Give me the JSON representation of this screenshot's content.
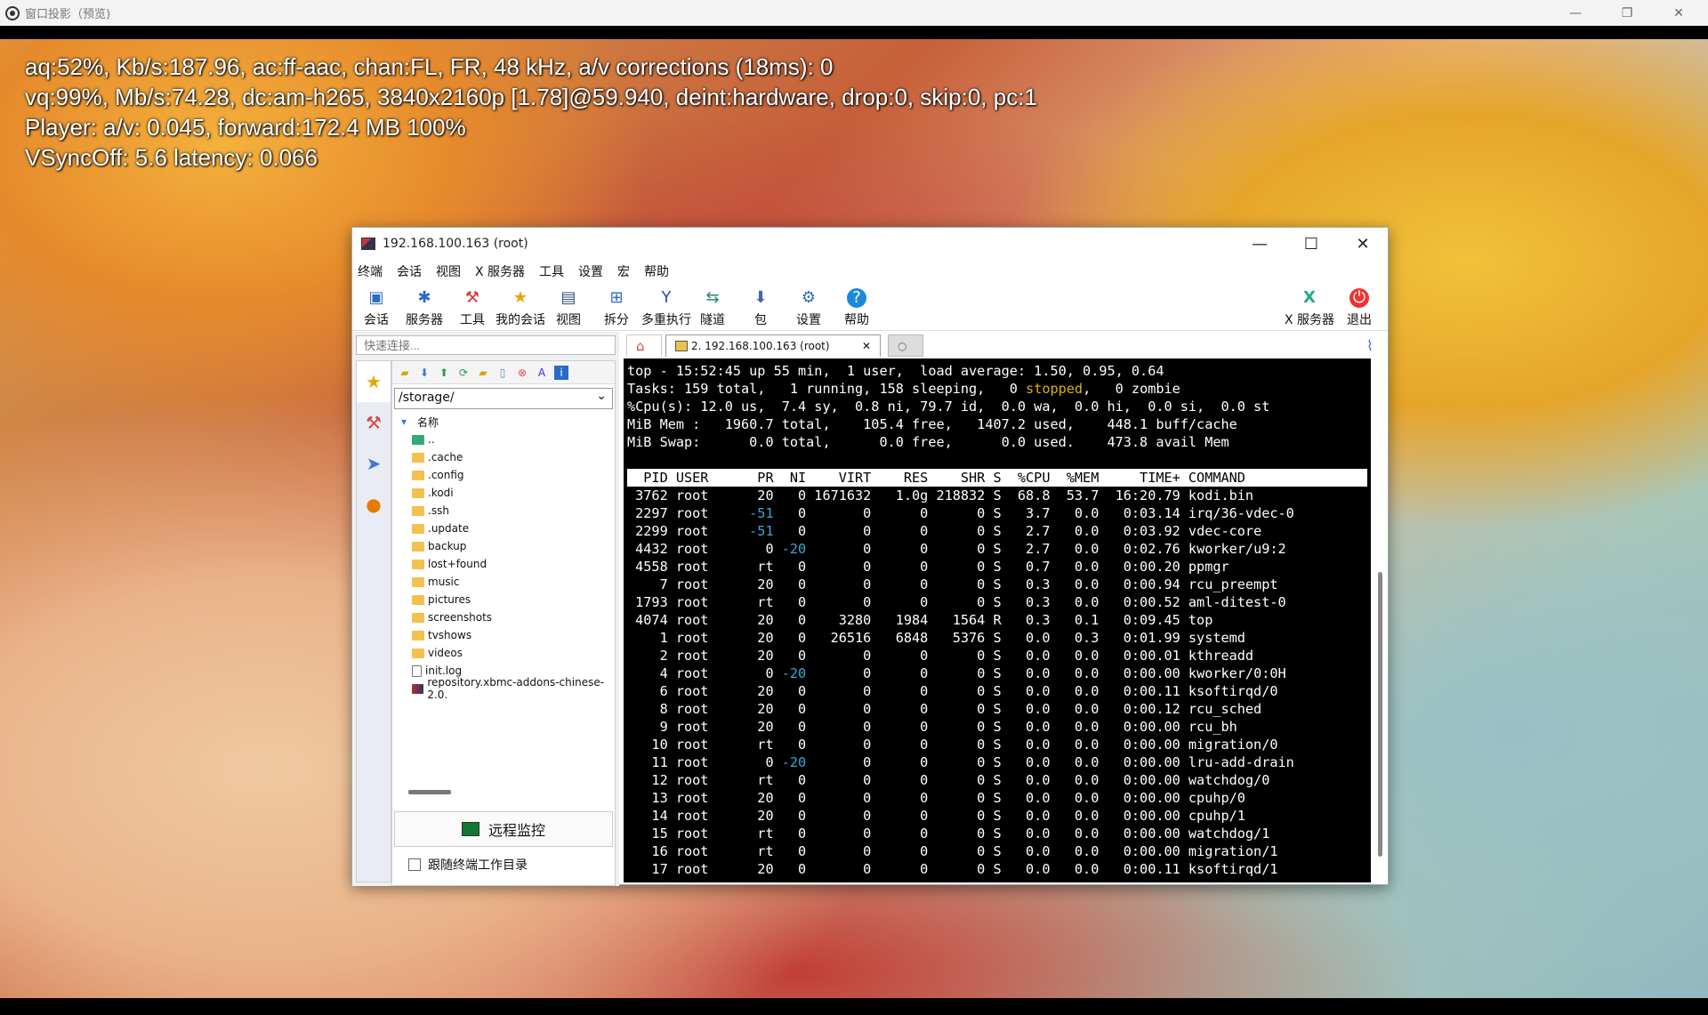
{
  "outer_window": {
    "title": "窗口投影（预览)",
    "minimize": "—",
    "restore": "❐",
    "close": "✕"
  },
  "osd": [
    "aq:52%, Kb/s:187.96, ac:ff-aac, chan:FL, FR, 48 kHz, a/v corrections (18ms): 0",
    "vq:99%, Mb/s:74.28, dc:am-h265, 3840x2160p [1.78]@59.940, deint:hardware, drop:0, skip:0, pc:1",
    "Player: a/v: 0.045,  forward:172.4 MB 100%",
    "VSyncOff: 5.6 latency: 0.066"
  ],
  "app": {
    "title": "192.168.100.163 (root)",
    "minimize": "—",
    "maximize": "☐",
    "close": "✕",
    "menu": [
      "终端",
      "会话",
      "视图",
      "X 服务器",
      "工具",
      "设置",
      "宏",
      "帮助"
    ],
    "toolbar": [
      {
        "label": "会话",
        "icon": "monitor-icon"
      },
      {
        "label": "服务器",
        "icon": "network-icon"
      },
      {
        "label": "工具",
        "icon": "tools-icon"
      },
      {
        "label": "我的会话",
        "icon": "star-icon"
      },
      {
        "label": "视图",
        "icon": "view-icon"
      },
      {
        "label": "拆分",
        "icon": "split-icon"
      },
      {
        "label": "多重执行",
        "icon": "fork-icon"
      },
      {
        "label": "隧道",
        "icon": "tunnel-icon"
      },
      {
        "label": "包",
        "icon": "package-icon"
      },
      {
        "label": "设置",
        "icon": "gear-icon"
      },
      {
        "label": "帮助",
        "icon": "help-icon"
      },
      {
        "label": "X 服务器",
        "icon": "x-server-icon"
      },
      {
        "label": "退出",
        "icon": "power-icon"
      }
    ],
    "quick_connect_placeholder": "快速连接...",
    "path": "/storage/",
    "tree_header": "名称",
    "files": [
      "..",
      ".cache",
      ".config",
      ".kodi",
      ".ssh",
      ".update",
      "backup",
      "lost+found",
      "music",
      "pictures",
      "screenshots",
      "tvshows",
      "videos",
      "init.log",
      "repository.xbmc-addons-chinese-2.0."
    ],
    "remote_monitor": "远程监控",
    "follow_dir": "跟随终端工作目录",
    "tab_label": "2. 192.168.100.163 (root)",
    "tab_close": "✕"
  },
  "terminal": {
    "summary": [
      "top - 15:52:45 up 55 min,  1 user,  load average: 1.50, 0.95, 0.64",
      "Tasks: 159 total,   1 running, 158 sleeping,   0 stopped,   0 zombie",
      "%Cpu(s): 12.0 us,  7.4 sy,  0.8 ni, 79.7 id,  0.0 wa,  0.0 hi,  0.0 si,  0.0 st",
      "MiB Mem :   1960.7 total,    105.4 free,   1407.2 used,    448.1 buff/cache",
      "MiB Swap:      0.0 total,      0.0 free,      0.0 used.    473.8 avail Mem"
    ],
    "header": "  PID USER      PR  NI    VIRT    RES    SHR S  %CPU  %MEM     TIME+ COMMAND",
    "rows": [
      " 3762 root      20   0 1671632   1.0g 218832 S  68.8  53.7  16:20.79 kodi.bin",
      " 2297 root     -51   0       0      0      0 S   3.7   0.0   0:03.14 irq/36-vdec-0",
      " 2299 root     -51   0       0      0      0 S   2.7   0.0   0:03.92 vdec-core",
      " 4432 root       0 -20       0      0      0 S   2.7   0.0   0:02.76 kworker/u9:2",
      " 4558 root      rt   0       0      0      0 S   0.7   0.0   0:00.20 ppmgr",
      "    7 root      20   0       0      0      0 S   0.3   0.0   0:00.94 rcu_preempt",
      " 1793 root      rt   0       0      0      0 S   0.3   0.0   0:00.52 aml-ditest-0",
      " 4074 root      20   0    3280   1984   1564 R   0.3   0.1   0:09.45 top",
      "    1 root      20   0   26516   6848   5376 S   0.0   0.3   0:01.99 systemd",
      "    2 root      20   0       0      0      0 S   0.0   0.0   0:00.01 kthreadd",
      "    4 root       0 -20       0      0      0 S   0.0   0.0   0:00.00 kworker/0:0H",
      "    6 root      20   0       0      0      0 S   0.0   0.0   0:00.11 ksoftirqd/0",
      "    8 root      20   0       0      0      0 S   0.0   0.0   0:00.12 rcu_sched",
      "    9 root      20   0       0      0      0 S   0.0   0.0   0:00.00 rcu_bh",
      "   10 root      rt   0       0      0      0 S   0.0   0.0   0:00.00 migration/0",
      "   11 root       0 -20       0      0      0 S   0.0   0.0   0:00.00 lru-add-drain",
      "   12 root      rt   0       0      0      0 S   0.0   0.0   0:00.00 watchdog/0",
      "   13 root      20   0       0      0      0 S   0.0   0.0   0:00.00 cpuhp/0",
      "   14 root      20   0       0      0      0 S   0.0   0.0   0:00.00 cpuhp/1",
      "   15 root      rt   0       0      0      0 S   0.0   0.0   0:00.00 watchdog/1",
      "   16 root      rt   0       0      0      0 S   0.0   0.0   0:00.00 migration/1",
      "   17 root      20   0       0      0      0 S   0.0   0.0   0:00.11 ksoftirqd/1"
    ]
  }
}
